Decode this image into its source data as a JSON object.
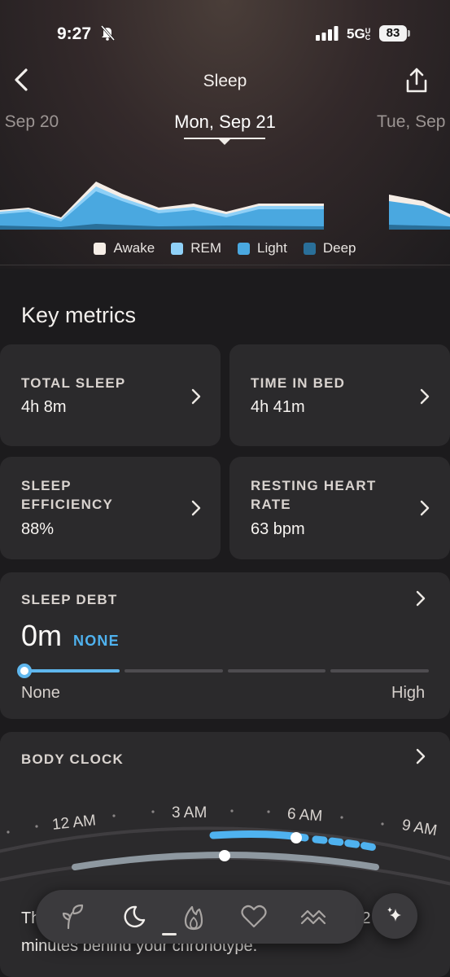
{
  "status_bar": {
    "time": "9:27",
    "network": "5G",
    "network_suffix": "UC",
    "battery": "83"
  },
  "header": {
    "title": "Sleep"
  },
  "date_nav": {
    "previous": ", Sep 20",
    "current": "Mon, Sep 21",
    "next": "Tue, Sep"
  },
  "legend": [
    {
      "label": "Awake",
      "color": "#f5ede6"
    },
    {
      "label": "REM",
      "color": "#8fd0f7"
    },
    {
      "label": "Light",
      "color": "#4aa8e0"
    },
    {
      "label": "Deep",
      "color": "#2a6f99"
    }
  ],
  "key_metrics": {
    "title": "Key metrics",
    "total_sleep": {
      "label": "TOTAL SLEEP",
      "value": "4h 8m"
    },
    "time_in_bed": {
      "label": "TIME IN BED",
      "value": "4h 41m"
    },
    "sleep_efficiency": {
      "label_1": "SLEEP",
      "label_2": "EFFICIENCY",
      "value": "88%"
    },
    "resting_heart_rate": {
      "label_1": "RESTING HEART",
      "label_2": "RATE",
      "value": "63 bpm"
    }
  },
  "sleep_debt": {
    "label": "SLEEP DEBT",
    "value": "0m",
    "status": "NONE",
    "scale_low": "None",
    "scale_high": "High",
    "level": 0
  },
  "body_clock": {
    "label": "BODY CLOCK",
    "times": [
      "12 AM",
      "3 AM",
      "6 AM",
      "9 AM"
    ],
    "message_start": "Th",
    "message_end": "2",
    "message_line2": "minutes behind your chronotype."
  },
  "tab_bar": {
    "tabs": [
      "sprout-icon",
      "moon-icon",
      "flame-icon",
      "heart-icon",
      "waves-icon"
    ],
    "active": "moon-icon",
    "fab_icon": "sparkle-icon"
  }
}
